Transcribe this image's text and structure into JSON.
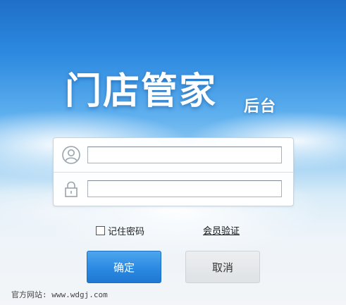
{
  "brand": {
    "title": "门店管家",
    "subtitle": "后台"
  },
  "form": {
    "username_value": "",
    "password_value": "",
    "user_icon": "user-avatar-icon",
    "lock_icon": "lock-icon"
  },
  "options": {
    "remember_label": "记住密码",
    "remember_checked": false,
    "verify_link": "会员验证"
  },
  "buttons": {
    "ok_label": "确定",
    "cancel_label": "取消"
  },
  "footer": {
    "site_text": "官方网站: www.wdgj.com"
  },
  "colors": {
    "sky_top": "#1f6fc8",
    "primary_button": "#2b89e2",
    "secondary_button": "#dfe2e5"
  }
}
